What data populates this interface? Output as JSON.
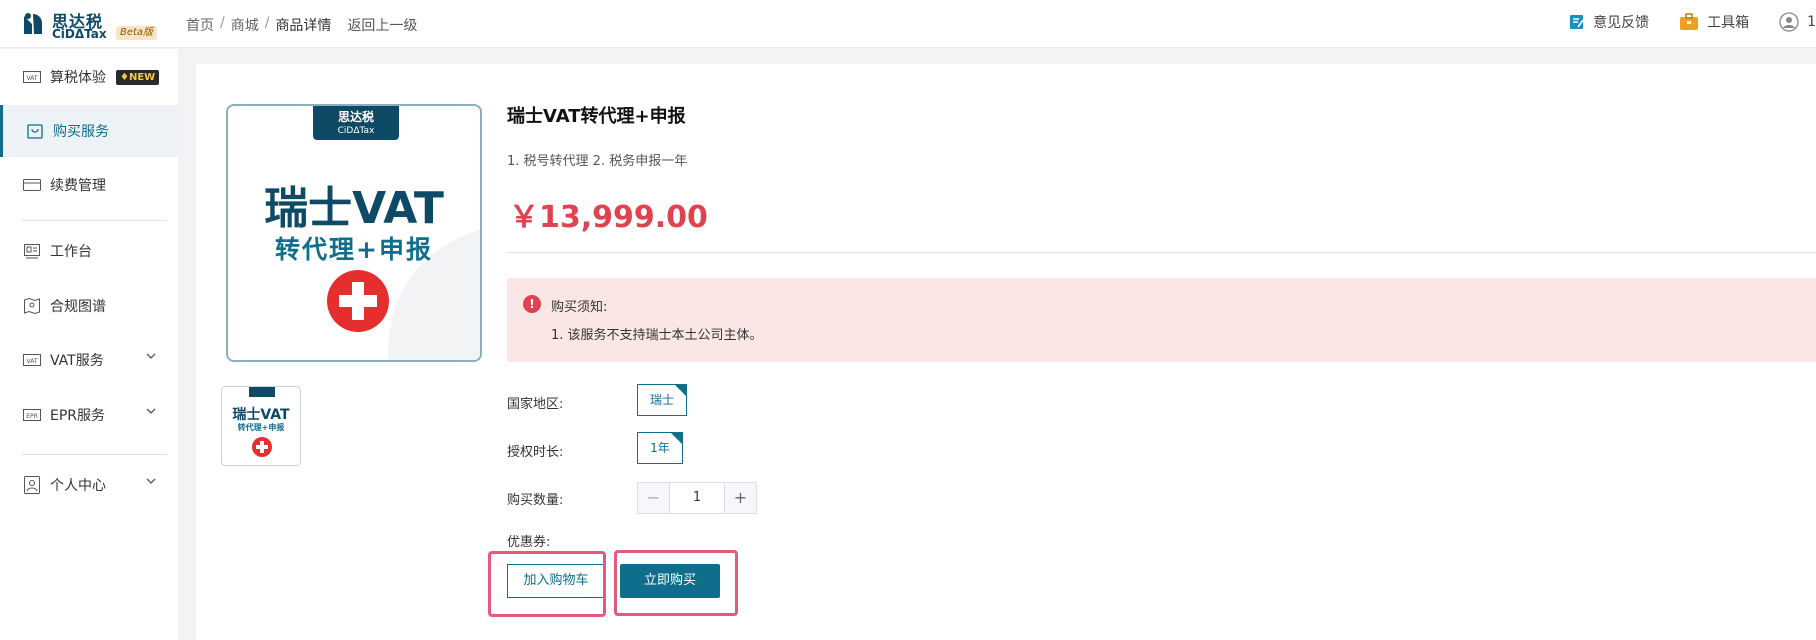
{
  "header": {
    "logo_cn": "思达税",
    "logo_en": "CiDΔTax",
    "beta": "Beta版",
    "breadcrumb": [
      "首页",
      "商城",
      "商品详情"
    ],
    "back": "返回上一级",
    "feedback": "意见反馈",
    "toolbox": "工具箱",
    "user": "1"
  },
  "sidebar": {
    "items": [
      {
        "label": "算税体验",
        "icon": "vat-icon",
        "badge": "NEW"
      },
      {
        "label": "购买服务",
        "icon": "shopping-bag-icon"
      },
      {
        "label": "续费管理",
        "icon": "card-icon"
      },
      {
        "label": "工作台",
        "icon": "workbench-icon"
      },
      {
        "label": "合规图谱",
        "icon": "map-icon"
      },
      {
        "label": "VAT服务",
        "icon": "vat-icon"
      },
      {
        "label": "EPR服务",
        "icon": "epr-icon"
      },
      {
        "label": "个人中心",
        "icon": "user-icon"
      }
    ]
  },
  "product": {
    "image_logo_cn": "思达税",
    "image_logo_en": "CiDΔTax",
    "image_title": "瑞士VAT",
    "image_subtitle": "转代理+申报",
    "thumb_title": "瑞士VAT",
    "thumb_subtitle": "转代理+申报",
    "title": "瑞士VAT转代理+申报",
    "desc": "1. 税号转代理 2. 税务申报一年",
    "price": "￥13,999.00",
    "notice_title": "购买须知:",
    "notice_line": "1. 该服务不支持瑞士本土公司主体。",
    "region_label": "国家地区:",
    "region_value": "瑞士",
    "duration_label": "授权时长:",
    "duration_value": "1年",
    "qty_label": "购买数量:",
    "qty_value": "1",
    "coupon_label": "优惠券:",
    "add_cart": "加入购物车",
    "buy_now": "立即购买"
  },
  "colors": {
    "brand": "#0e6e8c",
    "price": "#e0434f",
    "highlight": "#e25a7c"
  }
}
